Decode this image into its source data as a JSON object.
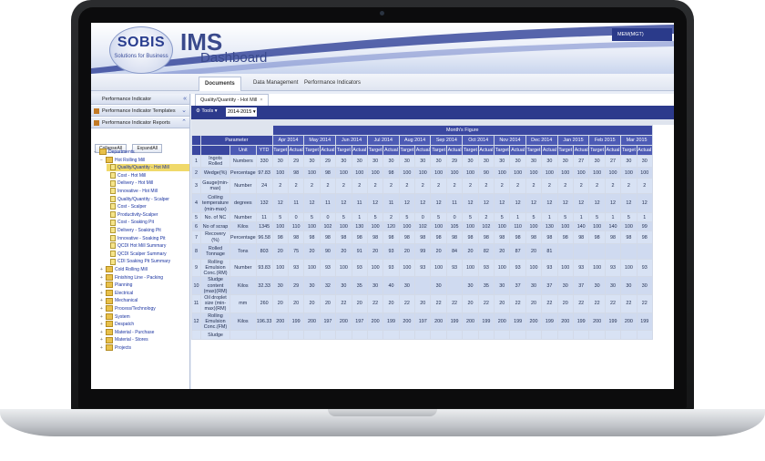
{
  "header": {
    "logo_word": "SOBIS",
    "logo_tagline": "Solutions for Business",
    "app_title": "IMS",
    "app_subtitle": "Dashboard",
    "user_label": "MEM(MGT)"
  },
  "nav": {
    "tabs": [
      {
        "label": "Documents",
        "active": true
      },
      {
        "label": "Data Management",
        "active": false
      },
      {
        "label": "Performance Indicators",
        "active": false
      }
    ]
  },
  "left_panel": {
    "sections": [
      {
        "label": "Performance Indicator",
        "icon": "collapse-icon"
      },
      {
        "label": "Performance Indicator Templates",
        "icon": "folder-icon"
      },
      {
        "label": "Performance Indicator Reports",
        "icon": "folder-icon"
      }
    ],
    "collapse_all": "CollapseAll",
    "expand_all": "ExpandAll",
    "tree": [
      {
        "label": "Departments",
        "depth": 0,
        "type": "folder",
        "toggle": "−"
      },
      {
        "label": "Hot Rolling Mill",
        "depth": 1,
        "type": "folder",
        "toggle": "−"
      },
      {
        "label": "Quality/Quantity - Hot Mill",
        "depth": 2,
        "type": "doc",
        "selected": true
      },
      {
        "label": "Cost - Hot Mill",
        "depth": 2,
        "type": "doc"
      },
      {
        "label": "Delivery - Hot Mill",
        "depth": 2,
        "type": "doc"
      },
      {
        "label": "Innovative - Hot Mill",
        "depth": 2,
        "type": "doc"
      },
      {
        "label": "Quality/Quantity - Scalper",
        "depth": 2,
        "type": "doc"
      },
      {
        "label": "Cost - Scalper",
        "depth": 2,
        "type": "doc"
      },
      {
        "label": "Productivity-Scalper",
        "depth": 2,
        "type": "doc"
      },
      {
        "label": "Cost - Soaking Pit",
        "depth": 2,
        "type": "doc"
      },
      {
        "label": "Delivery - Soaking Pit",
        "depth": 2,
        "type": "doc"
      },
      {
        "label": "Innovative - Soaking Pit",
        "depth": 2,
        "type": "doc"
      },
      {
        "label": "QCDI Hot Mill Summary",
        "depth": 2,
        "type": "doc"
      },
      {
        "label": "QCDI Scalper Summary",
        "depth": 2,
        "type": "doc"
      },
      {
        "label": "CDI Soaking Pit Summary",
        "depth": 2,
        "type": "doc"
      },
      {
        "label": "Cold Rolling Mill",
        "depth": 1,
        "type": "folder",
        "toggle": "+"
      },
      {
        "label": "Finishing Line - Packing",
        "depth": 1,
        "type": "folder",
        "toggle": "+"
      },
      {
        "label": "Planning",
        "depth": 1,
        "type": "folder",
        "toggle": "+"
      },
      {
        "label": "Electrical",
        "depth": 1,
        "type": "folder",
        "toggle": "+"
      },
      {
        "label": "Mechanical",
        "depth": 1,
        "type": "folder",
        "toggle": "+"
      },
      {
        "label": "Process/Technology",
        "depth": 1,
        "type": "folder",
        "toggle": "+"
      },
      {
        "label": "System",
        "depth": 1,
        "type": "folder",
        "toggle": "+"
      },
      {
        "label": "Despatch",
        "depth": 1,
        "type": "folder",
        "toggle": "+"
      },
      {
        "label": "Material - Purchase",
        "depth": 1,
        "type": "folder",
        "toggle": "+"
      },
      {
        "label": "Material - Stores",
        "depth": 1,
        "type": "folder",
        "toggle": "+"
      },
      {
        "label": "Projects",
        "depth": 1,
        "type": "folder",
        "toggle": "+"
      }
    ]
  },
  "report": {
    "tab_label": "Quality/Quantity - Hot Mill",
    "tools_label": "Tools",
    "year_value": "2014-2015",
    "group_header": "Month's Figure",
    "param_header": "Parameter",
    "unit_header": "Unit",
    "ytd_header": "YTD",
    "months": [
      "Apr 2014",
      "May 2014",
      "Jun 2014",
      "Jul 2014",
      "Aug 2014",
      "Sep 2014",
      "Oct 2014",
      "Nov 2014",
      "Dec 2014",
      "Jan 2015",
      "Feb 2015",
      "Mar 2015"
    ],
    "target_label": "Target",
    "actual_label": "Actual",
    "rows": [
      {
        "no": "1",
        "param": "Ingots Rolled",
        "unit": "Numbers",
        "ytd": "330",
        "vals": [
          "30",
          "29",
          "30",
          "29",
          "30",
          "30",
          "30",
          "30",
          "30",
          "30",
          "30",
          "29",
          "30",
          "30",
          "30",
          "30",
          "30",
          "30",
          "30",
          "27",
          "30",
          "27",
          "30",
          "30"
        ]
      },
      {
        "no": "2",
        "param": "Wedge(%)",
        "unit": "Percentage",
        "ytd": "97.83",
        "vals": [
          "100",
          "98",
          "100",
          "98",
          "100",
          "100",
          "100",
          "98",
          "100",
          "100",
          "100",
          "100",
          "100",
          "90",
          "100",
          "100",
          "100",
          "100",
          "100",
          "100",
          "100",
          "100",
          "100",
          "100"
        ]
      },
      {
        "no": "3",
        "param": "Gauge(min-max)",
        "unit": "Number",
        "ytd": "24",
        "vals": [
          "2",
          "2",
          "2",
          "2",
          "2",
          "2",
          "2",
          "2",
          "2",
          "2",
          "2",
          "2",
          "2",
          "2",
          "2",
          "2",
          "2",
          "2",
          "2",
          "2",
          "2",
          "2",
          "2",
          "2"
        ]
      },
      {
        "no": "4",
        "param": "Coiling temperature (min-max)",
        "unit": "degrees",
        "ytd": "132",
        "vals": [
          "12",
          "11",
          "12",
          "11",
          "12",
          "11",
          "12",
          "11",
          "12",
          "12",
          "12",
          "11",
          "12",
          "12",
          "12",
          "12",
          "12",
          "12",
          "12",
          "12",
          "12",
          "12",
          "12",
          "12"
        ]
      },
      {
        "no": "5",
        "param": "No. of NC",
        "unit": "Number",
        "ytd": "11",
        "vals": [
          "5",
          "0",
          "5",
          "0",
          "5",
          "1",
          "5",
          "2",
          "5",
          "0",
          "5",
          "0",
          "5",
          "2",
          "5",
          "1",
          "5",
          "1",
          "5",
          "1",
          "5",
          "1",
          "5",
          "1"
        ]
      },
      {
        "no": "6",
        "param": "No of scrap",
        "unit": "Kilos",
        "ytd": "1345",
        "vals": [
          "100",
          "110",
          "100",
          "102",
          "100",
          "130",
          "100",
          "120",
          "100",
          "102",
          "100",
          "105",
          "100",
          "102",
          "100",
          "110",
          "100",
          "130",
          "100",
          "140",
          "100",
          "140",
          "100",
          "99"
        ]
      },
      {
        "no": "7",
        "param": "Recovery (%)",
        "unit": "Percentage",
        "ytd": "96.58",
        "vals": [
          "98",
          "98",
          "98",
          "98",
          "98",
          "98",
          "98",
          "98",
          "98",
          "98",
          "98",
          "98",
          "98",
          "98",
          "98",
          "98",
          "98",
          "98",
          "98",
          "98",
          "98",
          "98",
          "98",
          "98"
        ]
      },
      {
        "no": "8",
        "param": "Rolled Tonnage",
        "unit": "Tons",
        "ytd": "803",
        "vals": [
          "20",
          "75",
          "20",
          "90",
          "20",
          "91",
          "20",
          "93",
          "20",
          "99",
          "20",
          "84",
          "20",
          "82",
          "20",
          "87",
          "20",
          "81",
          "",
          "",
          "",
          "",
          "",
          ""
        ]
      },
      {
        "no": "9",
        "param": "Rolling Emulsion Conc.(RM)",
        "unit": "Number",
        "ytd": "93.83",
        "vals": [
          "100",
          "93",
          "100",
          "93",
          "100",
          "93",
          "100",
          "93",
          "100",
          "93",
          "100",
          "93",
          "100",
          "93",
          "100",
          "93",
          "100",
          "93",
          "100",
          "93",
          "100",
          "93",
          "100",
          "93"
        ]
      },
      {
        "no": "10",
        "param": "Sludge content (max)(RM)",
        "unit": "Kilos",
        "ytd": "32.33",
        "vals": [
          "30",
          "29",
          "30",
          "32",
          "30",
          "35",
          "30",
          "40",
          "30",
          "",
          "30",
          "",
          "30",
          "35",
          "30",
          "37",
          "30",
          "37",
          "30",
          "37",
          "30",
          "30",
          "30",
          "30"
        ]
      },
      {
        "no": "11",
        "param": "Oil droplet size (min-max)(RM)",
        "unit": "mm",
        "ytd": "260",
        "vals": [
          "20",
          "20",
          "20",
          "20",
          "22",
          "20",
          "22",
          "20",
          "22",
          "20",
          "22",
          "22",
          "20",
          "22",
          "20",
          "22",
          "20",
          "22",
          "20",
          "22",
          "22",
          "22",
          "22",
          "22"
        ]
      },
      {
        "no": "12",
        "param": "Rolling Emulsion Conc.(FM)",
        "unit": "Kilos",
        "ytd": "196.33",
        "vals": [
          "200",
          "199",
          "200",
          "197",
          "200",
          "197",
          "200",
          "199",
          "200",
          "197",
          "200",
          "199",
          "200",
          "199",
          "200",
          "199",
          "200",
          "199",
          "200",
          "199",
          "200",
          "199",
          "200",
          "199"
        ]
      },
      {
        "no": "",
        "param": "Sludge",
        "unit": "",
        "ytd": "",
        "vals": [
          "",
          "",
          "",
          "",
          "",
          "",
          "",
          "",
          "",
          "",
          "",
          "",
          "",
          "",
          "",
          "",
          "",
          "",
          "",
          "",
          "",
          "",
          "",
          ""
        ]
      }
    ]
  }
}
